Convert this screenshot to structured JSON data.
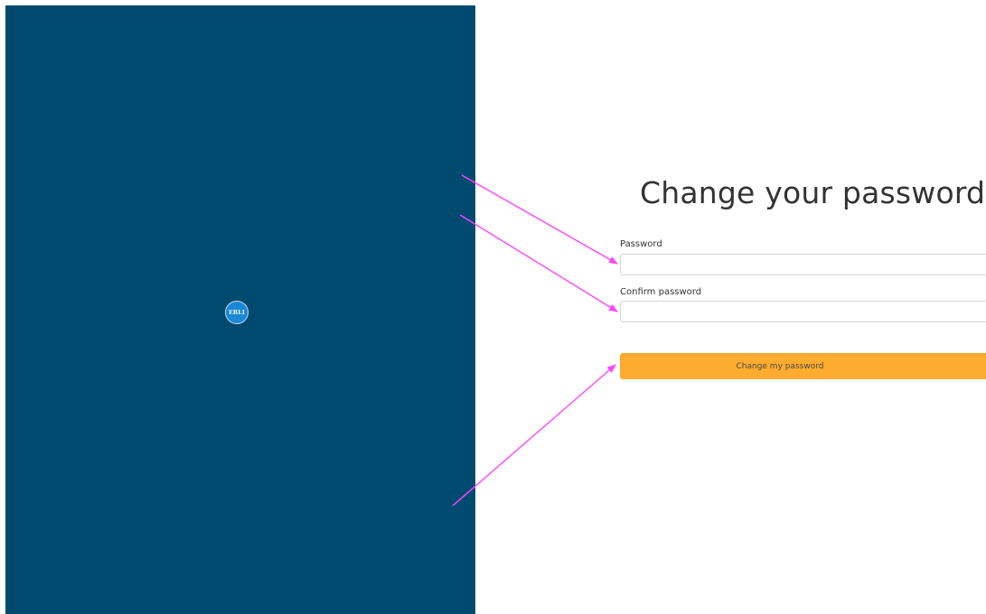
{
  "branding": {
    "logo_text": "EBLI",
    "panel_color": "#004a70",
    "logo_color": "#1a88d6"
  },
  "form": {
    "title": "Change your password",
    "password_label": "Password",
    "password_value": "",
    "confirm_label": "Confirm password",
    "confirm_value": "",
    "submit_label": "Change my password",
    "submit_color": "#fdac2f"
  },
  "annotations": {
    "color": "#ff44ff",
    "arrows": [
      "arrow-to-password-field",
      "arrow-to-confirm-field",
      "arrow-to-submit-button"
    ]
  }
}
